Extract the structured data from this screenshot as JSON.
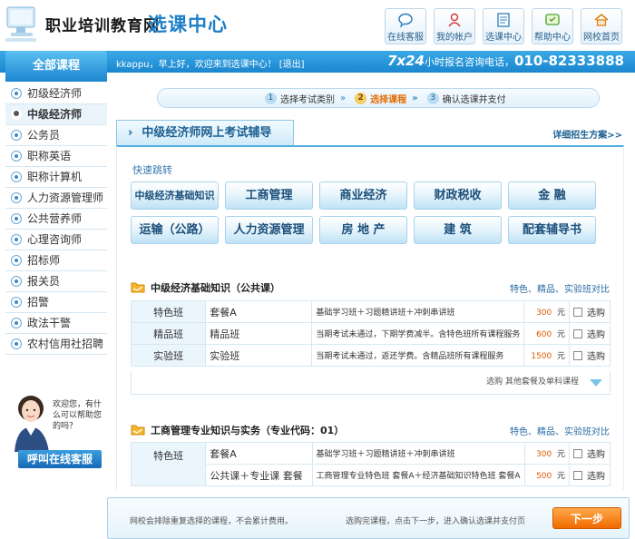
{
  "header": {
    "site_name": "职业培训教育网",
    "site_sub": "选课中心",
    "nav": [
      {
        "label": "在线客服",
        "icon": "chat-icon"
      },
      {
        "label": "我的帐户",
        "icon": "user-icon"
      },
      {
        "label": "选课中心",
        "icon": "document-icon"
      },
      {
        "label": "帮助中心",
        "icon": "help-icon"
      },
      {
        "label": "网校首页",
        "icon": "home-icon"
      }
    ]
  },
  "topbar": {
    "welcome": "kkappu，早上好，欢迎来到选课中心！",
    "logout": "[退出]",
    "hotline_big": "7x24",
    "hotline_text": "小时报名咨询电话，",
    "hotline_num": "010-82333888"
  },
  "sidebar": {
    "title": "全部课程",
    "items": [
      "初级经济师",
      "中级经济师",
      "公务员",
      "职称英语",
      "职称计算机",
      "人力资源管理师",
      "公共营养师",
      "心理咨询师",
      "招标师",
      "报关员",
      "招警",
      "政法干警",
      "农村信用社招聘"
    ],
    "active_index": 1,
    "cs_bubble": "欢迎您，有什么可以帮助您的吗？",
    "cs_button": "呼叫在线客服"
  },
  "steps": [
    {
      "num": "1",
      "label": "选择考试类别"
    },
    {
      "num": "2",
      "label": "选择课程"
    },
    {
      "num": "3",
      "label": "确认选课并支付"
    }
  ],
  "main": {
    "title": "中级经济师网上考试辅导",
    "more_link": "详细招生方案>>",
    "quick_label": "快速跳转",
    "quick_links": [
      "中级经济基础知识",
      "工商管理",
      "商业经济",
      "财政税收",
      "金 融",
      "运输（公路）",
      "人力资源管理",
      "房 地 产",
      "建 筑",
      "配套辅导书"
    ]
  },
  "courses": [
    {
      "title": "中级经济基础知识（公共课）",
      "right": "特色、精品、实验班对比",
      "rows": [
        {
          "cat": "特色班",
          "pkg": "套餐A",
          "desc": "基础学习班＋习题精讲班＋冲刺串讲班",
          "price": "300",
          "unit": "元",
          "sel": "选购"
        },
        {
          "cat": "精品班",
          "pkg": "精品班",
          "desc": "当期考试未通过，下期学费减半。含特色班所有课程服务",
          "price": "600",
          "unit": "元",
          "sel": "选购"
        },
        {
          "cat": "实验班",
          "pkg": "实验班",
          "desc": "当期考试未通过，返还学费。含精品班所有课程服务",
          "price": "1500",
          "unit": "元",
          "sel": "选购"
        }
      ],
      "other": "选购 其他套餐及单科课程"
    },
    {
      "title": "工商管理专业知识与实务（专业代码：01）",
      "right": "特色、精品、实验班对比",
      "rows": [
        {
          "cat": "特色班",
          "pkg": "套餐A",
          "desc": "基础学习班＋习题精讲班＋冲刺串讲班",
          "price": "300",
          "unit": "元",
          "sel": "选购"
        },
        {
          "cat": "",
          "pkg": "公共课＋专业课 套餐",
          "desc": "工商管理专业特色班 套餐A＋经济基础知识特色班 套餐A",
          "price": "500",
          "unit": "元",
          "sel": "选购"
        }
      ]
    }
  ],
  "footer": {
    "note": "网校会排除重复选择的课程，不会累计费用。",
    "hint": "选购完课程，点击下一步，进入确认选课并支付页",
    "next": "下一步"
  }
}
